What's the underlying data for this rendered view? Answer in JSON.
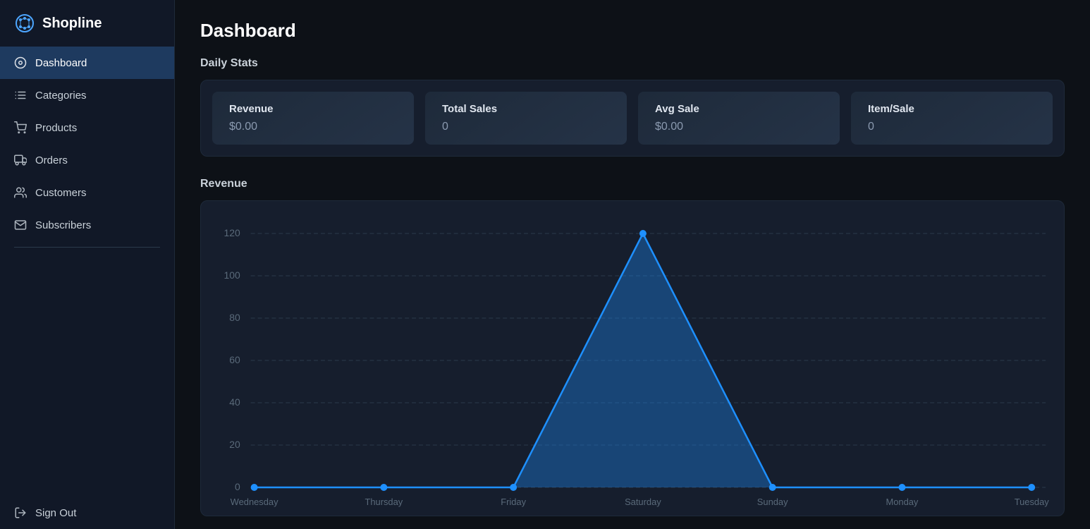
{
  "app": {
    "name": "Shopline"
  },
  "sidebar": {
    "items": [
      {
        "id": "dashboard",
        "label": "Dashboard",
        "icon": "dashboard-icon",
        "active": true
      },
      {
        "id": "categories",
        "label": "Categories",
        "icon": "categories-icon",
        "active": false
      },
      {
        "id": "products",
        "label": "Products",
        "icon": "products-icon",
        "active": false
      },
      {
        "id": "orders",
        "label": "Orders",
        "icon": "orders-icon",
        "active": false
      },
      {
        "id": "customers",
        "label": "Customers",
        "icon": "customers-icon",
        "active": false
      },
      {
        "id": "subscribers",
        "label": "Subscribers",
        "icon": "subscribers-icon",
        "active": false
      }
    ],
    "sign_out_label": "Sign Out"
  },
  "main": {
    "page_title": "Dashboard",
    "daily_stats_title": "Daily Stats",
    "stats": [
      {
        "label": "Revenue",
        "value": "$0.00"
      },
      {
        "label": "Total Sales",
        "value": "0"
      },
      {
        "label": "Avg Sale",
        "value": "$0.00"
      },
      {
        "label": "Item/Sale",
        "value": "0"
      }
    ],
    "revenue_title": "Revenue",
    "chart": {
      "y_labels": [
        "0",
        "20",
        "40",
        "60",
        "80",
        "100",
        "120"
      ],
      "x_labels": [
        "Wednesday",
        "Thursday",
        "Friday",
        "Saturday",
        "Sunday",
        "Monday",
        "Tuesday"
      ],
      "data_points": [
        0,
        0,
        0,
        120,
        0,
        0,
        0
      ]
    }
  }
}
